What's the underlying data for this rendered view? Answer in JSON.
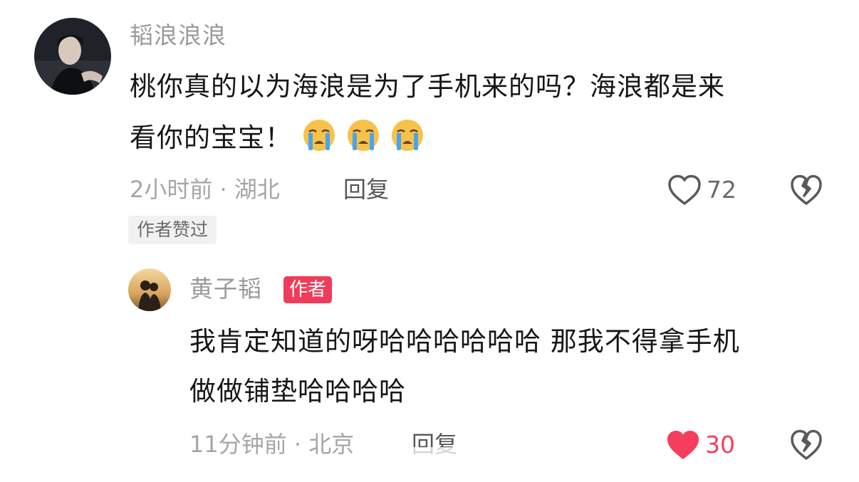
{
  "comment": {
    "username": "韬浪浪浪",
    "text_line1": "桃你真的以为海浪是为了手机来的吗？海浪都是来",
    "text_line2": "看你的宝宝！",
    "emojis": [
      "crying-face-icon",
      "crying-face-icon",
      "crying-face-icon"
    ],
    "time_location": "2小时前 · 湖北",
    "reply_label": "回复",
    "like_count": "72",
    "author_liked_badge": "作者赞过"
  },
  "reply": {
    "username": "黄子韬",
    "author_badge": "作者",
    "text_line1": "我肯定知道的呀哈哈哈哈哈哈 那我不得拿手机",
    "text_line2": "做做铺垫哈哈哈哈",
    "time_location": "11分钟前 · 北京",
    "reply_label": "回复",
    "like_count": "30",
    "liked": true
  },
  "colors": {
    "liked_heart": "#f53d5c",
    "author_badge_bg": "#f03c5a",
    "muted_text": "#a6a6a6"
  }
}
